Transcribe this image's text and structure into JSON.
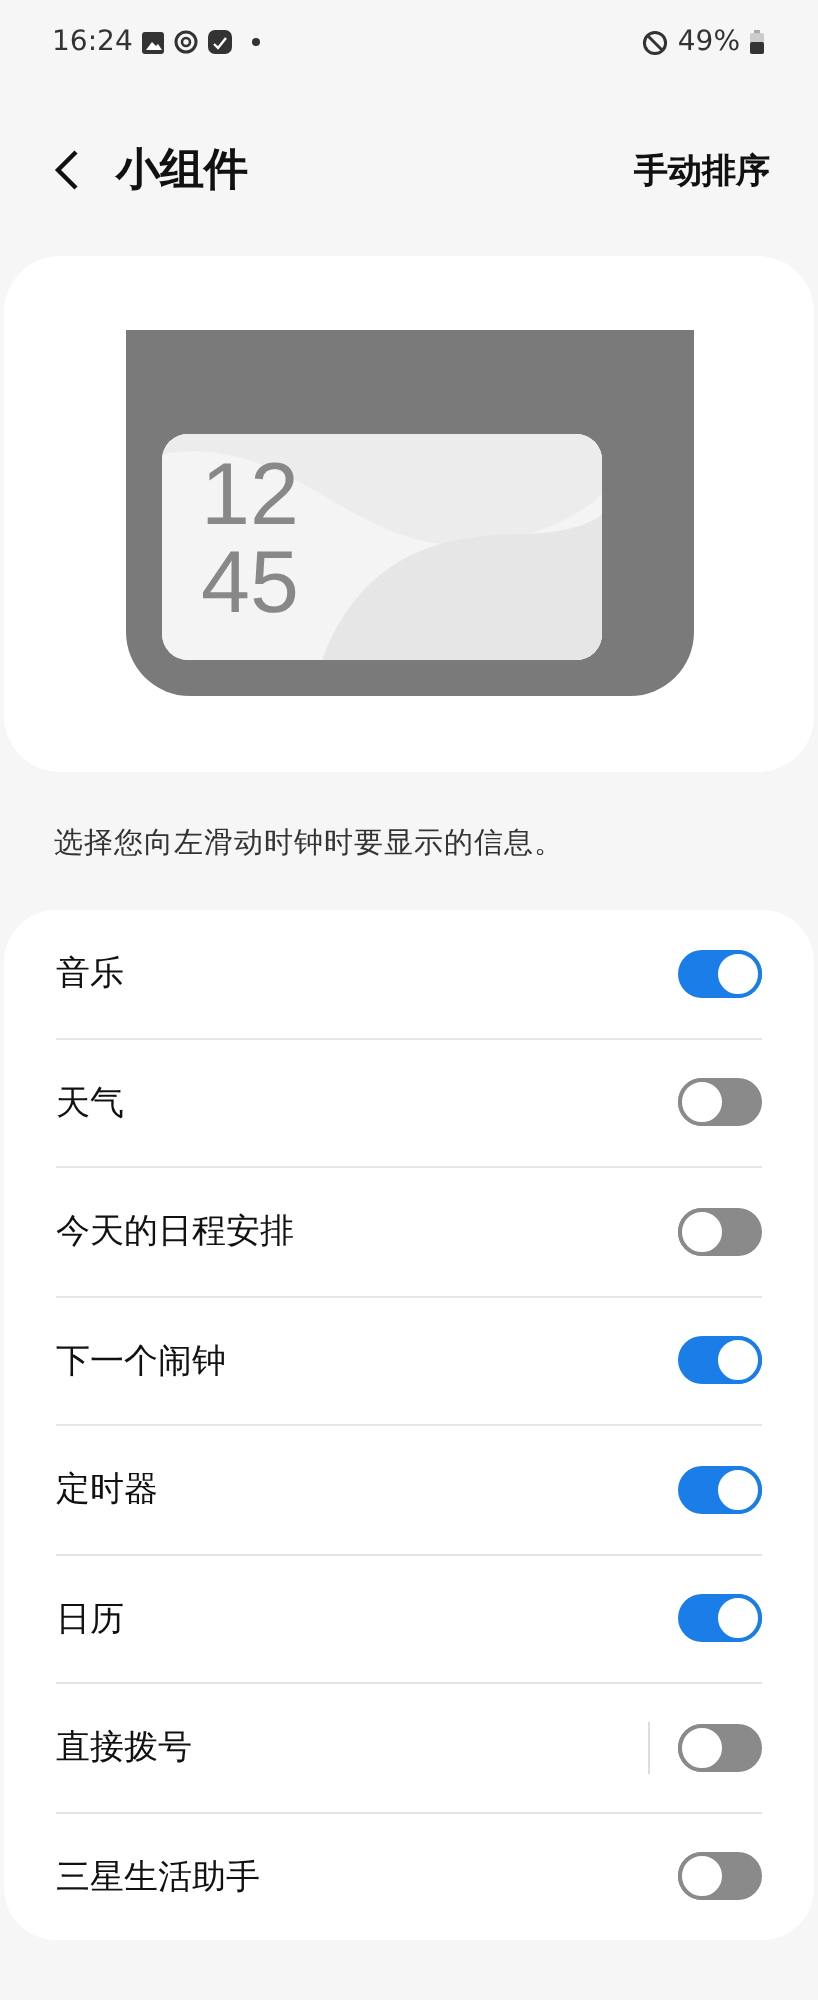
{
  "status_bar": {
    "time": "16:24",
    "battery": "49%"
  },
  "header": {
    "title": "小组件",
    "action": "手动排序"
  },
  "preview": {
    "hour": "12",
    "minute": "45"
  },
  "description": "选择您向左滑动时钟时要显示的信息。",
  "items": [
    {
      "label": "音乐",
      "on": true,
      "has_settings": false
    },
    {
      "label": "天气",
      "on": false,
      "has_settings": false
    },
    {
      "label": "今天的日程安排",
      "on": false,
      "has_settings": false
    },
    {
      "label": "下一个闹钟",
      "on": true,
      "has_settings": false
    },
    {
      "label": "定时器",
      "on": true,
      "has_settings": false
    },
    {
      "label": "日历",
      "on": true,
      "has_settings": false
    },
    {
      "label": "直接拨号",
      "on": false,
      "has_settings": true
    },
    {
      "label": "三星生活助手",
      "on": false,
      "has_settings": false
    }
  ]
}
